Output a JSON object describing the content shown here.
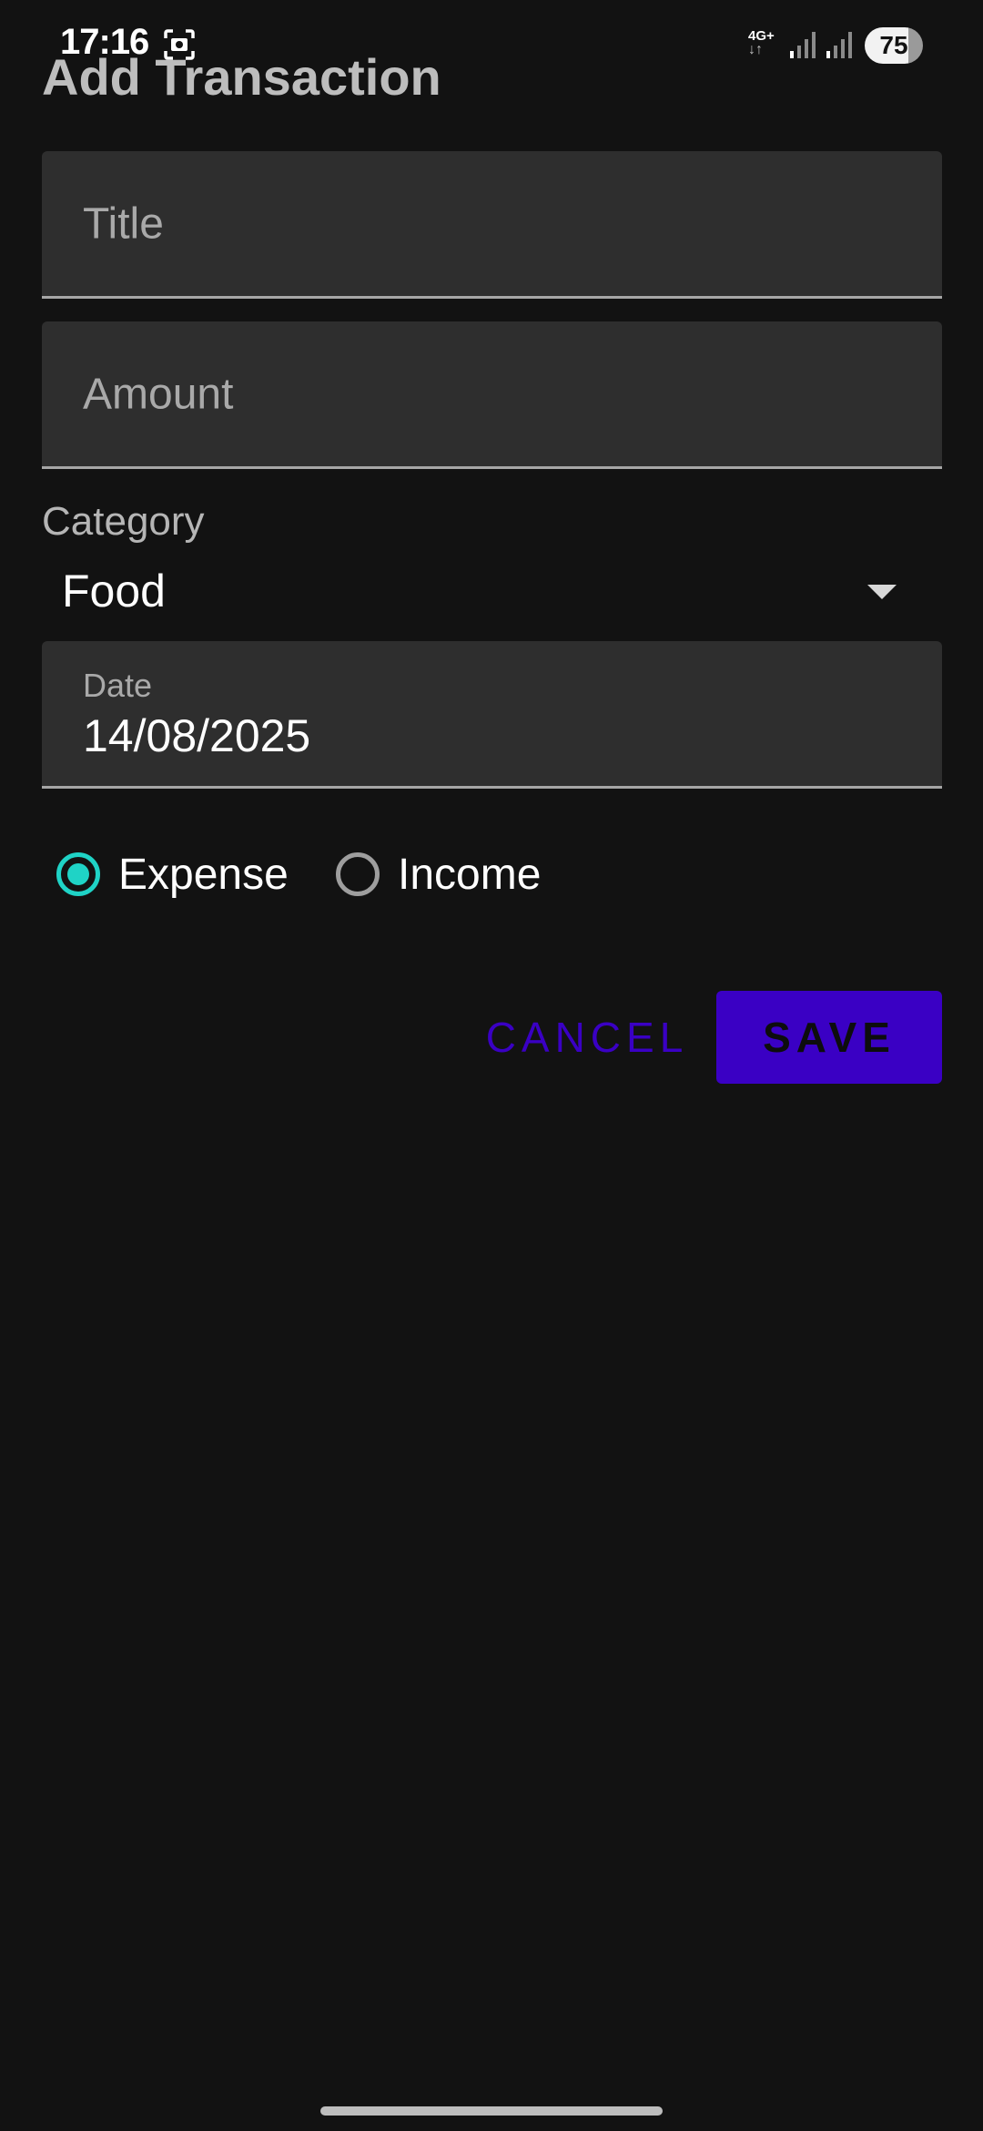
{
  "status_bar": {
    "time": "17:16",
    "network_type": "4G+",
    "network_arrows": "↓↑",
    "battery": "75",
    "icons": [
      "screenshot-icon",
      "signal-icon",
      "signal-icon"
    ]
  },
  "title": "Add Transaction",
  "form": {
    "title_field": {
      "placeholder": "Title",
      "value": ""
    },
    "amount_field": {
      "placeholder": "Amount",
      "value": ""
    },
    "category": {
      "label": "Category",
      "selected": "Food"
    },
    "date_field": {
      "label": "Date",
      "value": "14/08/2025"
    },
    "type": {
      "options": [
        {
          "label": "Expense",
          "checked": true
        },
        {
          "label": "Income",
          "checked": false
        }
      ]
    }
  },
  "actions": {
    "cancel_label": "CANCEL",
    "save_label": "SAVE"
  },
  "colors": {
    "background": "#121212",
    "accent": "#3a00c4",
    "radio_checked": "#1fd3c6"
  }
}
